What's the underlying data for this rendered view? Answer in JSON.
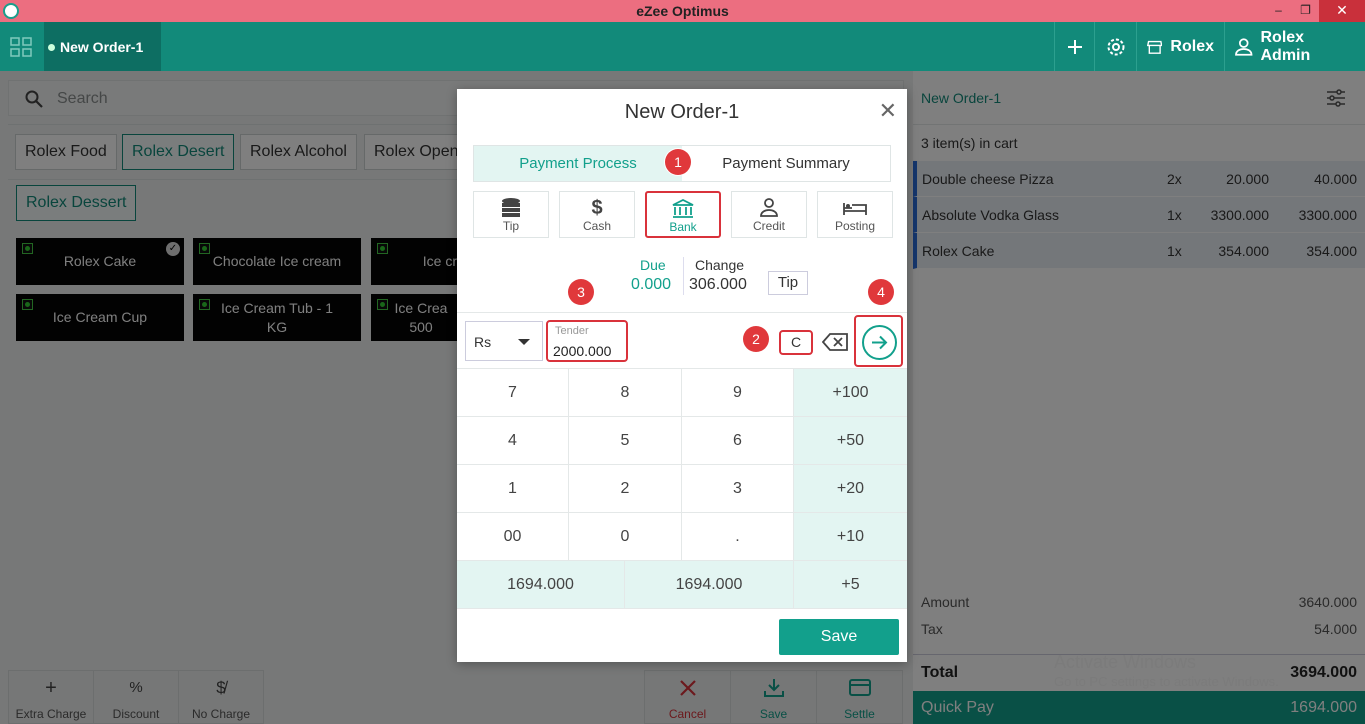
{
  "window": {
    "title": "eZee Optimus",
    "controls": [
      "–",
      "❐",
      "✕"
    ]
  },
  "header": {
    "order_tab": "New Order-1",
    "outlet": "Rolex",
    "user": "Rolex Admin"
  },
  "search": {
    "placeholder": "Search"
  },
  "categories": [
    "Rolex Food",
    "Rolex Desert",
    "Rolex Alcohol",
    "Rolex Open"
  ],
  "active_category": "Rolex Desert",
  "subcategory": "Rolex Dessert",
  "products": [
    "Rolex Cake",
    "Chocolate Ice cream",
    "Ice cr",
    "Ice Cream Cup",
    "Ice Cream Tub - 1 KG",
    "Ice Crea 500"
  ],
  "bottom_actions": {
    "extra_charge": "Extra Charge",
    "discount": "Discount",
    "no_charge": "No Charge",
    "cancel": "Cancel",
    "save": "Save",
    "settle": "Settle"
  },
  "cart": {
    "title": "New Order-1",
    "count_text": "3 item(s) in cart",
    "items": [
      {
        "name": "Double cheese Pizza",
        "qty": "2x",
        "price": "20.000",
        "total": "40.000"
      },
      {
        "name": "Absolute Vodka Glass",
        "qty": "1x",
        "price": "3300.000",
        "total": "3300.000"
      },
      {
        "name": "Rolex Cake",
        "qty": "1x",
        "price": "354.000",
        "total": "354.000"
      }
    ],
    "amount_label": "Amount",
    "amount": "3640.000",
    "tax_label": "Tax",
    "tax": "54.000",
    "total_label": "Total",
    "total": "3694.000",
    "quickpay_label": "Quick Pay",
    "quickpay": "1694.000"
  },
  "watermark": {
    "line1": "Activate Windows",
    "line2": "Go to PC settings to activate Windows."
  },
  "modal": {
    "title": "New Order-1",
    "tabs": [
      "Payment Process",
      "Payment Summary"
    ],
    "modes": [
      "Tip",
      "Cash",
      "Bank",
      "Credit",
      "Posting"
    ],
    "active_mode": "Bank",
    "due_label": "Due",
    "due": "0.000",
    "change_label": "Change",
    "change": "306.000",
    "tip_button": "Tip",
    "currency": "Rs",
    "tender_label": "Tender",
    "tender_value": "2000.000",
    "clear_label": "C",
    "keypad": [
      [
        "7",
        "8",
        "9",
        "+100"
      ],
      [
        "4",
        "5",
        "6",
        "+50"
      ],
      [
        "1",
        "2",
        "3",
        "+20"
      ],
      [
        "00",
        "0",
        ".",
        "+10"
      ]
    ],
    "quick_amounts": [
      "1694.000",
      "1694.000",
      "+5"
    ],
    "save_label": "Save"
  },
  "annotations": [
    "1",
    "2",
    "3",
    "4"
  ],
  "colors": {
    "accent": "#12a08c",
    "header": "#128a7a",
    "titlebar": "#ec6e80",
    "highlight": "#d9323b"
  }
}
